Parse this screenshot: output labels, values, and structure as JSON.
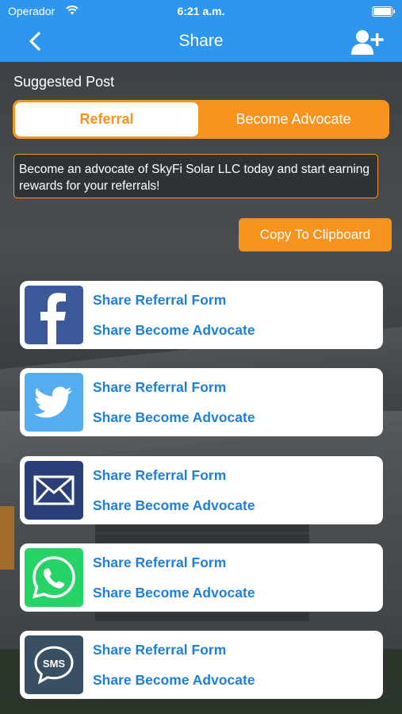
{
  "status_bar": {
    "carrier": "Operador",
    "time": "6:21 a.m."
  },
  "nav": {
    "title": "Share"
  },
  "suggested_post_label": "Suggested Post",
  "segments": {
    "active": "Referral",
    "inactive": "Become Advocate"
  },
  "message": "Become an advocate of SkyFi Solar LLC today and start earning rewards for your referrals!",
  "copy_button": "Copy To Clipboard",
  "share_cards": [
    {
      "icon": "facebook-icon",
      "color": "#3b5998",
      "referral": "Share Referral Form",
      "advocate": "Share Become Advocate"
    },
    {
      "icon": "twitter-icon",
      "color": "#55acee",
      "referral": "Share Referral Form",
      "advocate": "Share Become Advocate"
    },
    {
      "icon": "mail-icon",
      "color": "#2a3f78",
      "referral": "Share Referral Form",
      "advocate": "Share Become Advocate"
    },
    {
      "icon": "whatsapp-icon",
      "color": "#25d366",
      "referral": "Share Referral Form",
      "advocate": "Share Become Advocate"
    },
    {
      "icon": "sms-icon",
      "color": "#394f63",
      "referral": "Share Referral Form",
      "advocate": "Share Become Advocate"
    }
  ],
  "colors": {
    "nav_blue": "#2f96ee",
    "accent_orange": "#f7931e",
    "link_blue": "#1f7fd8"
  }
}
